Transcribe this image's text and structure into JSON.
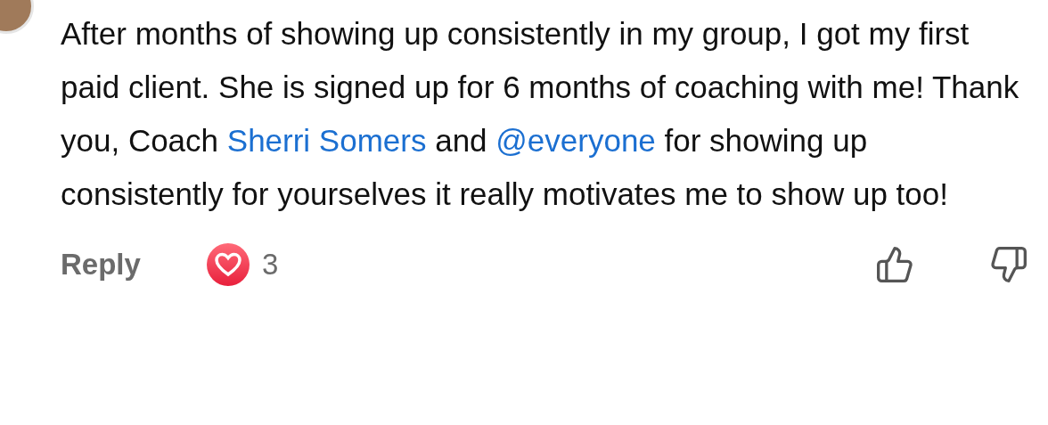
{
  "comment": {
    "segments": [
      {
        "kind": "text",
        "text": "After months of showing up consistently in my group, I got my first paid client. She is signed up for 6 months of coaching with me! Thank you, Coach "
      },
      {
        "kind": "link",
        "text": "Sherri Somers"
      },
      {
        "kind": "text",
        "text": " and "
      },
      {
        "kind": "link",
        "text": "@everyone"
      },
      {
        "kind": "text",
        "text": " for showing up consistently for yourselves it really motivates me to show up too!"
      }
    ],
    "reply_label": "Reply",
    "reaction_count": "3"
  }
}
